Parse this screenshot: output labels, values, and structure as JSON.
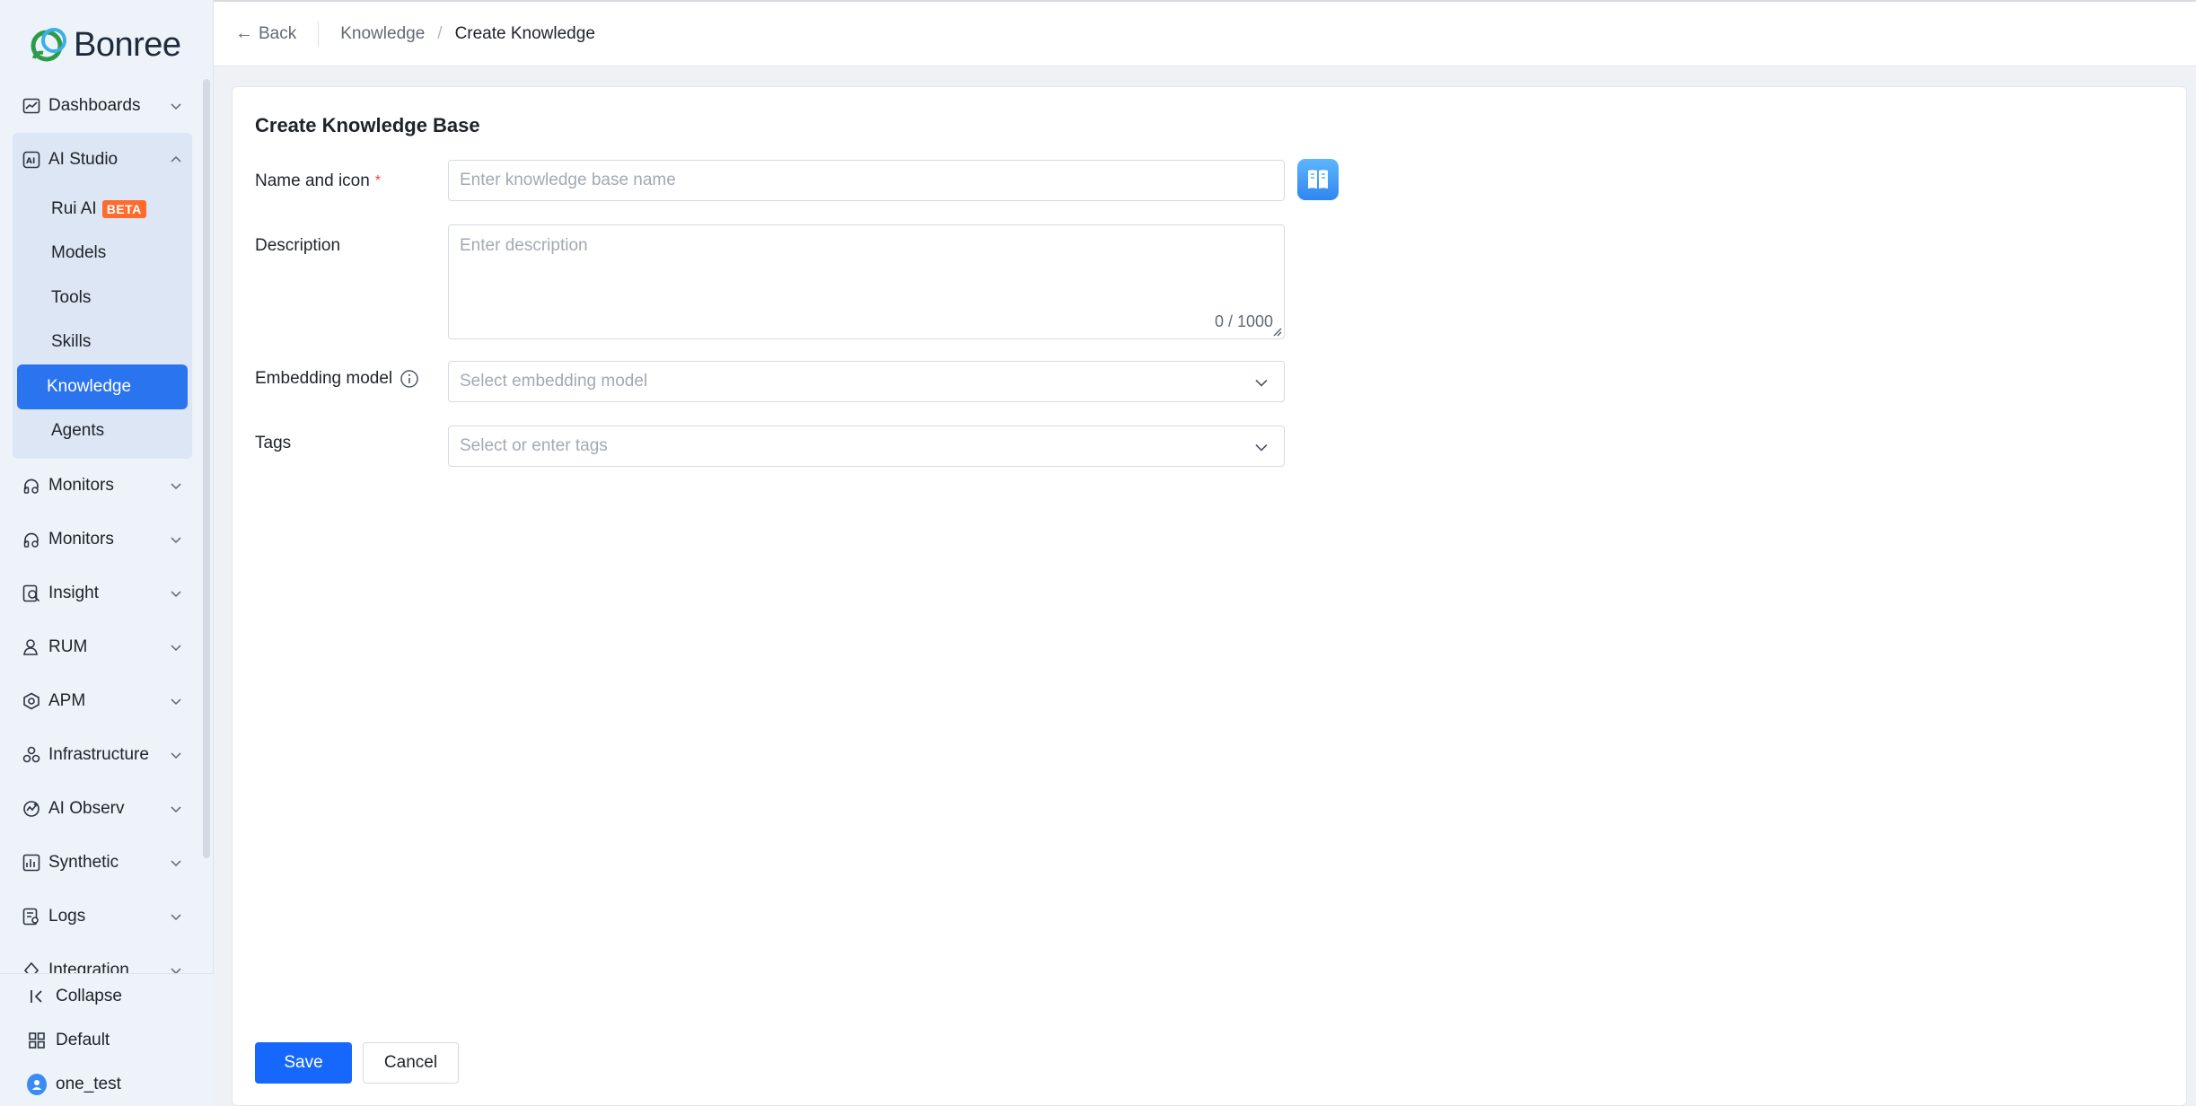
{
  "brand": {
    "name": "Bonree"
  },
  "sidebar": {
    "items_before": [
      {
        "label": "Dashboards",
        "icon": "chart-icon"
      }
    ],
    "open_group": {
      "label": "AI Studio",
      "icon": "ai-icon",
      "children": [
        {
          "label": "Rui AI",
          "badge": "BETA"
        },
        {
          "label": "Models"
        },
        {
          "label": "Tools"
        },
        {
          "label": "Skills"
        },
        {
          "label": "Knowledge",
          "active": true
        },
        {
          "label": "Agents"
        }
      ]
    },
    "items_after": [
      {
        "label": "Monitors",
        "icon": "monitor-icon"
      },
      {
        "label": "Monitors",
        "icon": "monitor-icon"
      },
      {
        "label": "Insight",
        "icon": "insight-icon"
      },
      {
        "label": "RUM",
        "icon": "rum-icon"
      },
      {
        "label": "APM",
        "icon": "apm-icon"
      },
      {
        "label": "Infrastructure",
        "icon": "infrastructure-icon"
      },
      {
        "label": "AI Observ",
        "icon": "ai-observ-icon"
      },
      {
        "label": "Synthetic",
        "icon": "synthetic-icon"
      },
      {
        "label": "Logs",
        "icon": "logs-icon"
      },
      {
        "label": "Integration",
        "icon": "integration-icon"
      }
    ],
    "bottom": {
      "collapse": "Collapse",
      "workspace": "Default",
      "user": "one_test"
    }
  },
  "header": {
    "back": "Back",
    "breadcrumb_parent": "Knowledge",
    "breadcrumb_sep": "/",
    "breadcrumb_current": "Create Knowledge"
  },
  "form": {
    "title": "Create Knowledge Base",
    "name_label": "Name and icon",
    "required_mark": "*",
    "name_placeholder": "Enter knowledge base name",
    "description_label": "Description",
    "description_placeholder": "Enter description",
    "description_counter": "0 / 1000",
    "embedding_label": "Embedding model",
    "embedding_placeholder": "Select embedding model",
    "tags_label": "Tags",
    "tags_placeholder": "Select or enter tags",
    "save": "Save",
    "cancel": "Cancel"
  },
  "colors": {
    "primary": "#1668fc",
    "active_nav": "#2b74ef",
    "beta_badge": "#ff6b2c",
    "required": "#f53f3f"
  }
}
